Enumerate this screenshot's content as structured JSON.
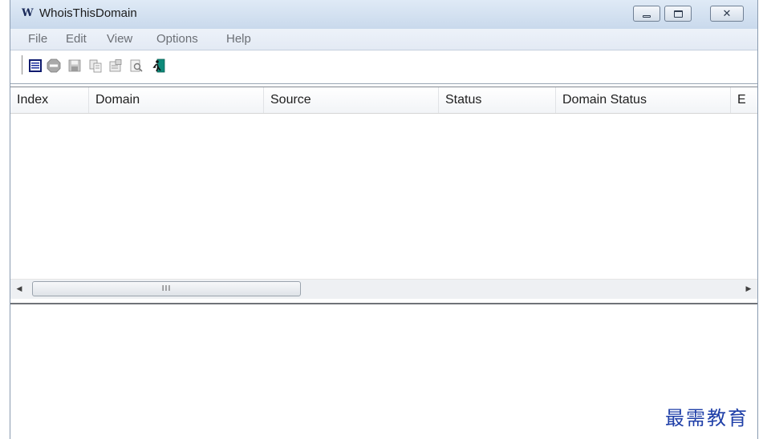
{
  "window": {
    "title": "WhoisThisDomain",
    "logo_text": "W",
    "close_glyph": "✕"
  },
  "menu": {
    "items": [
      "File",
      "Edit",
      "View",
      "Options",
      "Help"
    ]
  },
  "toolbar": {
    "icons": [
      "list-icon",
      "stop-icon",
      "save-icon",
      "copy-icon",
      "properties-icon",
      "find-icon",
      "exit-icon"
    ]
  },
  "list": {
    "columns": [
      "Index",
      "Domain",
      "Source",
      "Status",
      "Domain Status",
      "E"
    ],
    "rows": []
  },
  "scrollbar": {
    "left_arrow": "◀",
    "right_arrow": "▶",
    "thumb_grip": "III"
  },
  "watermark": "最需教育",
  "colors": {
    "titlebar": "#c9d9ec",
    "menu_text": "#6b6f75",
    "watermark": "#1f3fa8"
  }
}
